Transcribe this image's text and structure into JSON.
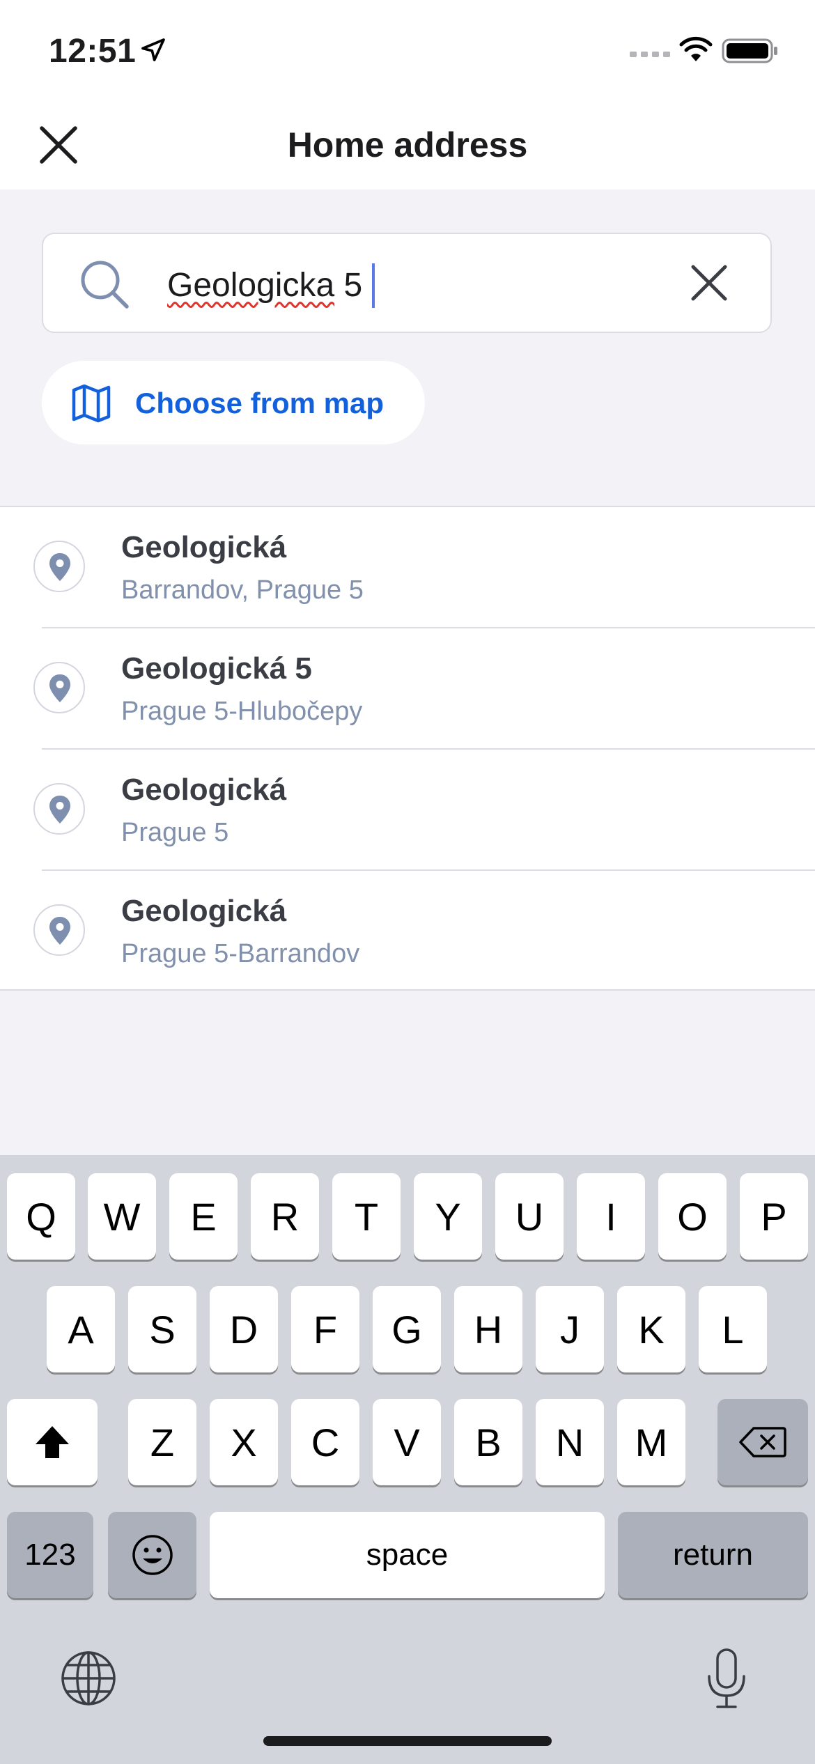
{
  "status_bar": {
    "time": "12:51"
  },
  "nav": {
    "title": "Home address"
  },
  "search": {
    "value_misspelled": "Geologicka",
    "value_rest": " 5"
  },
  "map_button": {
    "label": "Choose from map"
  },
  "results": [
    {
      "title": "Geologická",
      "subtitle": "Barrandov, Prague 5"
    },
    {
      "title": "Geologická 5",
      "subtitle": "Prague 5-Hlubočepy"
    },
    {
      "title": "Geologická",
      "subtitle": "Prague 5"
    },
    {
      "title": "Geologická",
      "subtitle": "Prague 5-Barrandov"
    }
  ],
  "keyboard": {
    "row1": [
      "Q",
      "W",
      "E",
      "R",
      "T",
      "Y",
      "U",
      "I",
      "O",
      "P"
    ],
    "row2": [
      "A",
      "S",
      "D",
      "F",
      "G",
      "H",
      "J",
      "K",
      "L"
    ],
    "row3": [
      "Z",
      "X",
      "C",
      "V",
      "B",
      "N",
      "M"
    ],
    "numbers_label": "123",
    "space_label": "space",
    "return_label": "return"
  },
  "colors": {
    "accent": "#1260dc",
    "pin": "#7d8eaf",
    "subtitle": "#8190ac"
  }
}
